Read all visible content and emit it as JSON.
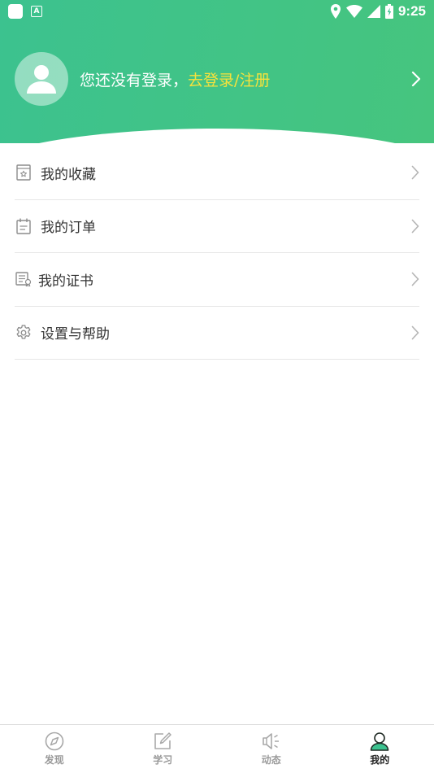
{
  "status_bar": {
    "time": "9:25",
    "icons": [
      "app-square-icon",
      "a-notification-icon",
      "location-icon",
      "wifi-icon",
      "signal-icon",
      "battery-icon"
    ]
  },
  "profile": {
    "prompt": "您还没有登录，",
    "login_link": "去登录/注册",
    "icons": [
      "avatar-icon",
      "chevron-right-icon"
    ]
  },
  "menu": {
    "items": [
      {
        "label": "我的收藏",
        "icon": "favorite-icon"
      },
      {
        "label": "我的订单",
        "icon": "order-icon"
      },
      {
        "label": "我的证书",
        "icon": "certificate-icon"
      },
      {
        "label": "设置与帮助",
        "icon": "settings-icon"
      }
    ]
  },
  "tabbar": {
    "tabs": [
      {
        "label": "发现",
        "icon": "compass-icon",
        "active": false
      },
      {
        "label": "学习",
        "icon": "edit-icon",
        "active": false
      },
      {
        "label": "动态",
        "icon": "speaker-icon",
        "active": false
      },
      {
        "label": "我的",
        "icon": "user-icon",
        "active": true
      }
    ]
  },
  "colors": {
    "header_green": "#3cc28f",
    "login_link": "#f6e23c",
    "text": "#333333",
    "divider": "#e6e6e6"
  }
}
